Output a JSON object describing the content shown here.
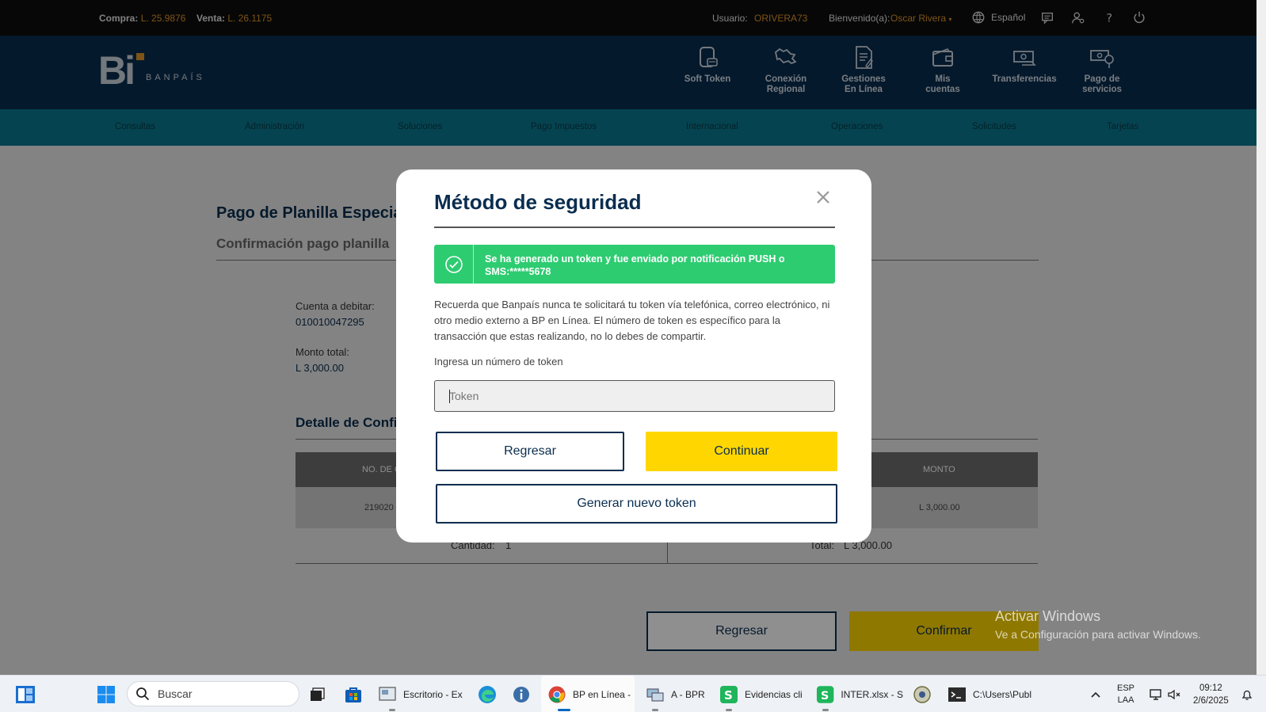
{
  "topbar": {
    "compra_label": "Compra:",
    "compra_value": "L. 25.9876",
    "venta_label": "Venta:",
    "venta_value": "L. 26.1175",
    "usuario_label": "Usuario:",
    "usuario_value": "ORIVERA73",
    "bienvenido_label": "Bienvenido(a):",
    "bienvenido_value": "Oscar Rivera",
    "language": "Español"
  },
  "logo": {
    "mark": "Bi",
    "text": "BANPAÍS"
  },
  "header_nav": [
    {
      "label1": "Soft Token",
      "label2": "",
      "icon": "phone-token-icon"
    },
    {
      "label1": "Conexión",
      "label2": "Regional",
      "icon": "map-connection-icon"
    },
    {
      "label1": "Gestiones",
      "label2": "En Línea",
      "icon": "document-icon"
    },
    {
      "label1": "Mis",
      "label2": "cuentas",
      "icon": "wallet-icon"
    },
    {
      "label1": "Transferencias",
      "label2": "",
      "icon": "money-transfer-icon"
    },
    {
      "label1": "Pago de",
      "label2": "servicios",
      "icon": "bill-pay-icon"
    }
  ],
  "menu": [
    "Consultas",
    "Administración",
    "Soluciones",
    "Pago Impuestos",
    "Internacional",
    "Operaciones",
    "Solicitudes",
    "Tarjetas"
  ],
  "page": {
    "title": "Pago de Planilla Especial",
    "subtitle": "Confirmación pago planilla",
    "cuenta_label": "Cuenta a debitar:",
    "cuenta_value": "010010047295",
    "monto_label": "Monto total:",
    "monto_value": "L  3,000.00",
    "detalle_title": "Detalle de Confi",
    "table_header_left": "NO. DE C",
    "table_header_right": "MONTO",
    "table_row_left": "219020",
    "table_row_right": "L 3,000.00",
    "cantidad_label": "Cantidad:",
    "cantidad_value": "1",
    "total_label": "Total:",
    "total_value": "L 3,000.00",
    "regresar_button": "Regresar",
    "confirmar_button": "Confirmar"
  },
  "watermark": {
    "line1": "Activar Windows",
    "line2": "Ve a Configuración para activar Windows."
  },
  "modal": {
    "title": "Método de seguridad",
    "alert_message": "Se ha generado un token y fue enviado por notificación PUSH o SMS:*****5678",
    "paragraph": "Recuerda que Banpaís nunca te solicitará tu token vía telefónica, correo electrónico, ni otro medio externo a BP en Línea. El número de token es específico para la transacción que estas realizando, no lo debes de compartir.",
    "input_label": "Ingresa un número de token",
    "input_placeholder": "Token",
    "input_value": "",
    "regresar_button": "Regresar",
    "continuar_button": "Continuar",
    "generar_button": "Generar nuevo token"
  },
  "taskbar": {
    "search_placeholder": "Buscar",
    "apps": [
      {
        "label": "Escritorio - Ex"
      },
      {
        "label": "BP en Línea -"
      },
      {
        "label": "A - BPR"
      },
      {
        "label": "Evidencias cli"
      },
      {
        "label": "INTER.xlsx - S"
      },
      {
        "label": "C:\\Users\\Publ"
      }
    ],
    "lang1": "ESP",
    "lang2": "LAA",
    "time": "09:12",
    "date": "2/6/2025"
  },
  "colors": {
    "navy": "#0a2d4f",
    "teal": "#0c7890",
    "orange": "#e0962a",
    "success_green": "#2ecc71",
    "yellow": "#ffd600"
  }
}
